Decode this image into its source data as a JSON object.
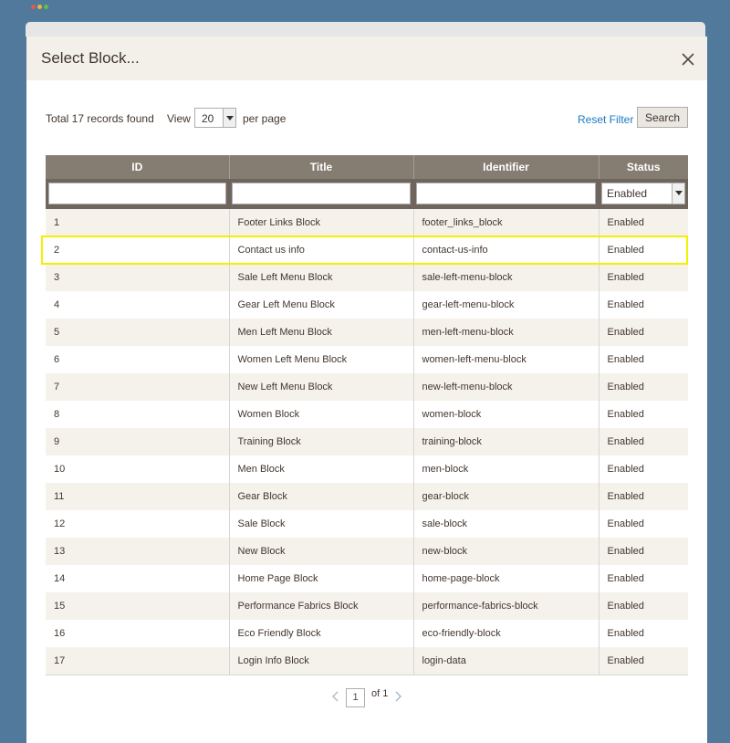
{
  "window": {
    "dots": [
      "#e05a4e",
      "#e6b73b",
      "#5fbf4a"
    ]
  },
  "modal": {
    "title": "Select Block...",
    "close_icon": "close-icon"
  },
  "toolbar": {
    "records_found": "Total 17 records found",
    "view_label": "View",
    "per_page_value": "20",
    "per_page_label": "per page",
    "reset_filter": "Reset Filter",
    "search": "Search"
  },
  "grid": {
    "columns": [
      "ID",
      "Title",
      "Identifier",
      "Status"
    ],
    "status_filter_value": "Enabled",
    "highlighted_row_id": "2",
    "rows": [
      {
        "id": "1",
        "title": "Footer Links Block",
        "identifier": "footer_links_block",
        "status": "Enabled"
      },
      {
        "id": "2",
        "title": "Contact us info",
        "identifier": "contact-us-info",
        "status": "Enabled"
      },
      {
        "id": "3",
        "title": "Sale Left Menu Block",
        "identifier": "sale-left-menu-block",
        "status": "Enabled"
      },
      {
        "id": "4",
        "title": "Gear Left Menu Block",
        "identifier": "gear-left-menu-block",
        "status": "Enabled"
      },
      {
        "id": "5",
        "title": "Men Left Menu Block",
        "identifier": "men-left-menu-block",
        "status": "Enabled"
      },
      {
        "id": "6",
        "title": "Women Left Menu Block",
        "identifier": "women-left-menu-block",
        "status": "Enabled"
      },
      {
        "id": "7",
        "title": "New Left Menu Block",
        "identifier": "new-left-menu-block",
        "status": "Enabled"
      },
      {
        "id": "8",
        "title": "Women Block",
        "identifier": "women-block",
        "status": "Enabled"
      },
      {
        "id": "9",
        "title": "Training Block",
        "identifier": "training-block",
        "status": "Enabled"
      },
      {
        "id": "10",
        "title": "Men Block",
        "identifier": "men-block",
        "status": "Enabled"
      },
      {
        "id": "11",
        "title": "Gear Block",
        "identifier": "gear-block",
        "status": "Enabled"
      },
      {
        "id": "12",
        "title": "Sale Block",
        "identifier": "sale-block",
        "status": "Enabled"
      },
      {
        "id": "13",
        "title": "New Block",
        "identifier": "new-block",
        "status": "Enabled"
      },
      {
        "id": "14",
        "title": "Home Page Block",
        "identifier": "home-page-block",
        "status": "Enabled"
      },
      {
        "id": "15",
        "title": "Performance Fabrics Block",
        "identifier": "performance-fabrics-block",
        "status": "Enabled"
      },
      {
        "id": "16",
        "title": "Eco Friendly Block",
        "identifier": "eco-friendly-block",
        "status": "Enabled"
      },
      {
        "id": "17",
        "title": "Login Info Block",
        "identifier": "login-data",
        "status": "Enabled"
      }
    ]
  },
  "pager": {
    "current_page": "1",
    "of_label": "of 1",
    "prev_icon": "chevron-left-icon",
    "next_icon": "chevron-right-icon"
  },
  "colors": {
    "page_bg": "#50799c",
    "header_bg": "#857d72",
    "link": "#1979c3",
    "highlight": "#f5f000"
  }
}
